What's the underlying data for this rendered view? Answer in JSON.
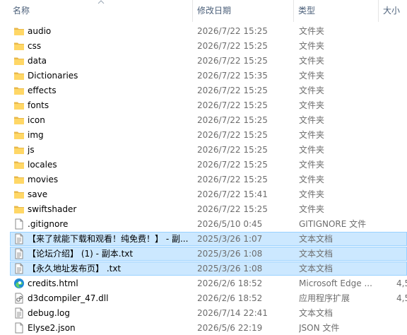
{
  "columns": {
    "name": "名称",
    "date": "修改日期",
    "type": "类型",
    "size": "大小"
  },
  "rows": [
    {
      "name": "audio",
      "date": "2026/7/22 15:25",
      "type": "文件夹",
      "size": "",
      "icon": "folder-icon"
    },
    {
      "name": "css",
      "date": "2026/7/22 15:25",
      "type": "文件夹",
      "size": "",
      "icon": "folder-icon"
    },
    {
      "name": "data",
      "date": "2026/7/22 15:25",
      "type": "文件夹",
      "size": "",
      "icon": "folder-icon"
    },
    {
      "name": "Dictionaries",
      "date": "2026/7/22 15:35",
      "type": "文件夹",
      "size": "",
      "icon": "folder-icon"
    },
    {
      "name": "effects",
      "date": "2026/7/22 15:25",
      "type": "文件夹",
      "size": "",
      "icon": "folder-icon"
    },
    {
      "name": "fonts",
      "date": "2026/7/22 15:25",
      "type": "文件夹",
      "size": "",
      "icon": "folder-icon"
    },
    {
      "name": "icon",
      "date": "2026/7/22 15:25",
      "type": "文件夹",
      "size": "",
      "icon": "folder-icon"
    },
    {
      "name": "img",
      "date": "2026/7/22 15:25",
      "type": "文件夹",
      "size": "",
      "icon": "folder-icon"
    },
    {
      "name": "js",
      "date": "2026/7/22 15:25",
      "type": "文件夹",
      "size": "",
      "icon": "folder-icon"
    },
    {
      "name": "locales",
      "date": "2026/7/22 15:25",
      "type": "文件夹",
      "size": "",
      "icon": "folder-icon"
    },
    {
      "name": "movies",
      "date": "2026/7/22 15:25",
      "type": "文件夹",
      "size": "",
      "icon": "folder-icon"
    },
    {
      "name": "save",
      "date": "2026/7/22 15:41",
      "type": "文件夹",
      "size": "",
      "icon": "folder-icon"
    },
    {
      "name": "swiftshader",
      "date": "2026/7/22 15:25",
      "type": "文件夹",
      "size": "",
      "icon": "folder-icon"
    },
    {
      "name": ".gitignore",
      "date": "2026/5/10 0:45",
      "type": "GITIGNORE 文件",
      "size": "",
      "icon": "file-icon"
    },
    {
      "name": "【来了就能下载和观看！纯免费！】 - 副...",
      "date": "2025/3/26 1:07",
      "type": "文本文档",
      "size": "",
      "icon": "text-file-icon",
      "selected": true
    },
    {
      "name": "【论坛介绍】 (1) - 副本.txt",
      "date": "2025/3/26 1:08",
      "type": "文本文档",
      "size": "",
      "icon": "text-file-icon",
      "selected": true
    },
    {
      "name": "【永久地址发布页】 .txt",
      "date": "2025/3/26 1:08",
      "type": "文本文档",
      "size": "",
      "icon": "text-file-icon",
      "selected": true
    },
    {
      "name": "credits.html",
      "date": "2026/2/6 18:52",
      "type": "Microsoft Edge ...",
      "size": "4,5",
      "icon": "edge-icon"
    },
    {
      "name": "d3dcompiler_47.dll",
      "date": "2026/2/6 18:52",
      "type": "应用程序扩展",
      "size": "4,5",
      "icon": "dll-icon"
    },
    {
      "name": "debug.log",
      "date": "2026/7/14 22:41",
      "type": "文本文档",
      "size": "",
      "icon": "text-file-icon"
    },
    {
      "name": "Elyse2.json",
      "date": "2026/5/6 22:19",
      "type": "JSON 文件",
      "size": "",
      "icon": "file-icon"
    }
  ]
}
